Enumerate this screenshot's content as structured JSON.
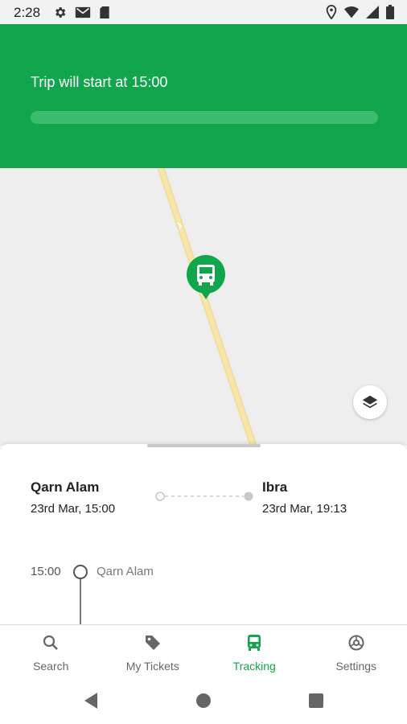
{
  "status_bar": {
    "time": "2:28",
    "icons_left": [
      "gear-icon",
      "gmail-icon",
      "sim-card-icon"
    ],
    "icons_right": [
      "location-icon",
      "wifi-icon",
      "signal-icon",
      "battery-icon"
    ]
  },
  "header": {
    "trip_status": "Trip will start at 15:00",
    "progress_fraction": 0,
    "background_color": "#11a64b"
  },
  "map": {
    "marker_icon": "bus-icon",
    "layers_button_icon": "layers-icon"
  },
  "route": {
    "from": {
      "name": "Qarn Alam",
      "datetime": "23rd Mar, 15:00"
    },
    "to": {
      "name": "Ibra",
      "datetime": "23rd Mar, 19:13"
    }
  },
  "timeline": {
    "stops": [
      {
        "time": "15:00",
        "name": "Qarn Alam"
      }
    ]
  },
  "bottom_nav": {
    "items": [
      {
        "label": "Search",
        "icon": "search-icon",
        "active": false
      },
      {
        "label": "My Tickets",
        "icon": "tag-icon",
        "active": false
      },
      {
        "label": "Tracking",
        "icon": "bus-icon",
        "active": true
      },
      {
        "label": "Settings",
        "icon": "settings-icon",
        "active": false
      }
    ],
    "active_color": "#11a64b"
  },
  "system_nav": {
    "buttons": [
      "back-icon",
      "home-icon",
      "recents-icon"
    ]
  }
}
